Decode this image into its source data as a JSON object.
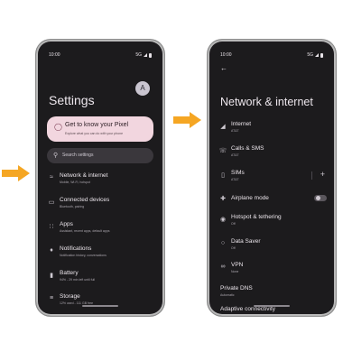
{
  "left_phone": {
    "status": {
      "time": "10:00",
      "network": "5G"
    },
    "avatar_letter": "A",
    "title": "Settings",
    "card": {
      "title": "Get to know your Pixel",
      "subtitle": "Explore what you can do with your phone"
    },
    "search_placeholder": "Search settings",
    "items": [
      {
        "title": "Network & internet",
        "subtitle": "Mobile, Wi-Fi, hotspot",
        "icon": "wifi-icon"
      },
      {
        "title": "Connected devices",
        "subtitle": "Bluetooth, pairing",
        "icon": "devices-icon"
      },
      {
        "title": "Apps",
        "subtitle": "Assistant, recent apps, default apps",
        "icon": "apps-icon"
      },
      {
        "title": "Notifications",
        "subtitle": "Notification history, conversations",
        "icon": "bell-icon"
      },
      {
        "title": "Battery",
        "subtitle": "94% - 29 min left until full",
        "icon": "battery-icon"
      },
      {
        "title": "Storage",
        "subtitle": "12% used - 111 GB free",
        "icon": "storage-icon"
      }
    ]
  },
  "right_phone": {
    "status": {
      "time": "10:00",
      "network": "5G"
    },
    "title": "Network & internet",
    "items": [
      {
        "title": "Internet",
        "subtitle": "AT&T",
        "icon": "signal-icon"
      },
      {
        "title": "Calls & SMS",
        "subtitle": "AT&T",
        "icon": "calls-sms-icon"
      },
      {
        "title": "SIMs",
        "subtitle": "AT&T",
        "icon": "sim-icon"
      },
      {
        "title": "Airplane mode",
        "subtitle": "",
        "icon": "airplane-icon"
      },
      {
        "title": "Hotspot & tethering",
        "subtitle": "Off",
        "icon": "hotspot-icon"
      },
      {
        "title": "Data Saver",
        "subtitle": "Off",
        "icon": "data-saver-icon"
      },
      {
        "title": "VPN",
        "subtitle": "None",
        "icon": "vpn-icon"
      },
      {
        "title": "Private DNS",
        "subtitle": "Automatic",
        "icon": ""
      },
      {
        "title": "Adaptive connectivity",
        "subtitle": "",
        "icon": ""
      }
    ]
  },
  "colors": {
    "arrow": "#f5a623",
    "card": "#f2d6df",
    "screen": "#1c1b1d"
  }
}
